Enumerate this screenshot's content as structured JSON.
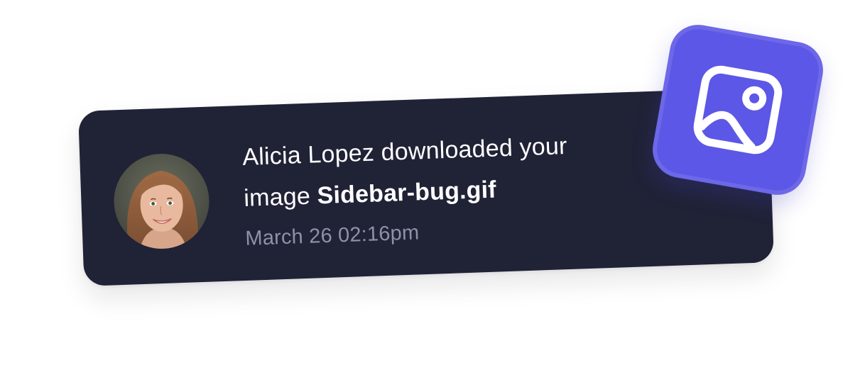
{
  "notification": {
    "actor_name": "Alicia Lopez",
    "action_text": " downloaded your image ",
    "file_name": "Sidebar-bug.gif",
    "timestamp": "March 26 02:16pm",
    "avatar_icon": "user-avatar-photo",
    "badge_icon": "image-icon"
  },
  "colors": {
    "card_background": "#202236",
    "badge_background": "#5c57e6",
    "timestamp_text": "#8f92a7",
    "message_text": "#ffffff"
  }
}
